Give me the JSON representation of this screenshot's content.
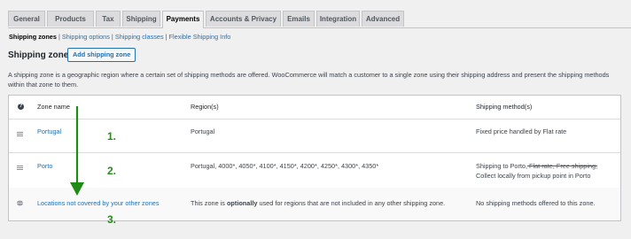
{
  "tabs": [
    "General",
    "Products",
    "Tax",
    "Shipping",
    "Payments",
    "Accounts & Privacy",
    "Emails",
    "Integration",
    "Advanced"
  ],
  "subnav": {
    "current": "Shipping zones",
    "sep": "|",
    "links": [
      "Shipping options",
      "Shipping classes",
      "Flexible Shipping Info"
    ]
  },
  "heading": "Shipping zones",
  "add_button": "Add shipping zone",
  "description": "A shipping zone is a geographic region where a certain set of shipping methods are offered. WooCommerce will match a customer to a single zone using their shipping address and present the shipping methods within that zone to them.",
  "table": {
    "headers": [
      "Zone name",
      "Region(s)",
      "Shipping method(s)"
    ],
    "header_icon": "?",
    "rows": [
      {
        "name": "Portugal",
        "region": "Portugal",
        "methods": "Fixed price handled by Flat rate"
      },
      {
        "name": "Porto",
        "region": "Portugal, 4000*, 4050*, 4100*, 4150*, 4200*, 4250*, 4300*, 4350*",
        "methods_prefix": "Shipping to Porto,",
        "methods_strike": " Flat rate, Free shipping,",
        "methods_line2": "Collect locally from pickup point in Porto"
      },
      {
        "name": "Locations not covered by your other zones",
        "region_pre": "This zone is ",
        "region_bold": "optionally",
        "region_post": " used for regions that are not included in any other shipping zone.",
        "methods": "No shipping methods offered to this zone."
      }
    ]
  },
  "annotations": [
    "1.",
    "2.",
    "3."
  ],
  "colors": {
    "link": "#2271b1",
    "annotation": "#2a8a1f"
  }
}
